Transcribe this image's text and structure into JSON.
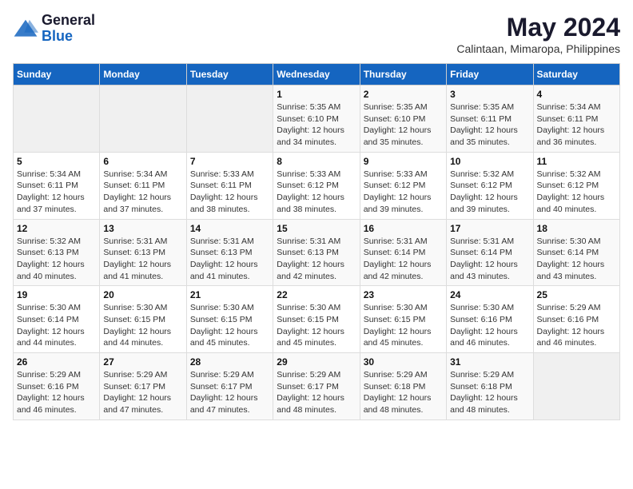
{
  "header": {
    "logo_general": "General",
    "logo_blue": "Blue",
    "month_year": "May 2024",
    "location": "Calintaan, Mimaropa, Philippines"
  },
  "days_of_week": [
    "Sunday",
    "Monday",
    "Tuesday",
    "Wednesday",
    "Thursday",
    "Friday",
    "Saturday"
  ],
  "weeks": [
    [
      {
        "day": "",
        "info": ""
      },
      {
        "day": "",
        "info": ""
      },
      {
        "day": "",
        "info": ""
      },
      {
        "day": "1",
        "info": "Sunrise: 5:35 AM\nSunset: 6:10 PM\nDaylight: 12 hours\nand 34 minutes."
      },
      {
        "day": "2",
        "info": "Sunrise: 5:35 AM\nSunset: 6:10 PM\nDaylight: 12 hours\nand 35 minutes."
      },
      {
        "day": "3",
        "info": "Sunrise: 5:35 AM\nSunset: 6:11 PM\nDaylight: 12 hours\nand 35 minutes."
      },
      {
        "day": "4",
        "info": "Sunrise: 5:34 AM\nSunset: 6:11 PM\nDaylight: 12 hours\nand 36 minutes."
      }
    ],
    [
      {
        "day": "5",
        "info": "Sunrise: 5:34 AM\nSunset: 6:11 PM\nDaylight: 12 hours\nand 37 minutes."
      },
      {
        "day": "6",
        "info": "Sunrise: 5:34 AM\nSunset: 6:11 PM\nDaylight: 12 hours\nand 37 minutes."
      },
      {
        "day": "7",
        "info": "Sunrise: 5:33 AM\nSunset: 6:11 PM\nDaylight: 12 hours\nand 38 minutes."
      },
      {
        "day": "8",
        "info": "Sunrise: 5:33 AM\nSunset: 6:12 PM\nDaylight: 12 hours\nand 38 minutes."
      },
      {
        "day": "9",
        "info": "Sunrise: 5:33 AM\nSunset: 6:12 PM\nDaylight: 12 hours\nand 39 minutes."
      },
      {
        "day": "10",
        "info": "Sunrise: 5:32 AM\nSunset: 6:12 PM\nDaylight: 12 hours\nand 39 minutes."
      },
      {
        "day": "11",
        "info": "Sunrise: 5:32 AM\nSunset: 6:12 PM\nDaylight: 12 hours\nand 40 minutes."
      }
    ],
    [
      {
        "day": "12",
        "info": "Sunrise: 5:32 AM\nSunset: 6:13 PM\nDaylight: 12 hours\nand 40 minutes."
      },
      {
        "day": "13",
        "info": "Sunrise: 5:31 AM\nSunset: 6:13 PM\nDaylight: 12 hours\nand 41 minutes."
      },
      {
        "day": "14",
        "info": "Sunrise: 5:31 AM\nSunset: 6:13 PM\nDaylight: 12 hours\nand 41 minutes."
      },
      {
        "day": "15",
        "info": "Sunrise: 5:31 AM\nSunset: 6:13 PM\nDaylight: 12 hours\nand 42 minutes."
      },
      {
        "day": "16",
        "info": "Sunrise: 5:31 AM\nSunset: 6:14 PM\nDaylight: 12 hours\nand 42 minutes."
      },
      {
        "day": "17",
        "info": "Sunrise: 5:31 AM\nSunset: 6:14 PM\nDaylight: 12 hours\nand 43 minutes."
      },
      {
        "day": "18",
        "info": "Sunrise: 5:30 AM\nSunset: 6:14 PM\nDaylight: 12 hours\nand 43 minutes."
      }
    ],
    [
      {
        "day": "19",
        "info": "Sunrise: 5:30 AM\nSunset: 6:14 PM\nDaylight: 12 hours\nand 44 minutes."
      },
      {
        "day": "20",
        "info": "Sunrise: 5:30 AM\nSunset: 6:15 PM\nDaylight: 12 hours\nand 44 minutes."
      },
      {
        "day": "21",
        "info": "Sunrise: 5:30 AM\nSunset: 6:15 PM\nDaylight: 12 hours\nand 45 minutes."
      },
      {
        "day": "22",
        "info": "Sunrise: 5:30 AM\nSunset: 6:15 PM\nDaylight: 12 hours\nand 45 minutes."
      },
      {
        "day": "23",
        "info": "Sunrise: 5:30 AM\nSunset: 6:15 PM\nDaylight: 12 hours\nand 45 minutes."
      },
      {
        "day": "24",
        "info": "Sunrise: 5:30 AM\nSunset: 6:16 PM\nDaylight: 12 hours\nand 46 minutes."
      },
      {
        "day": "25",
        "info": "Sunrise: 5:29 AM\nSunset: 6:16 PM\nDaylight: 12 hours\nand 46 minutes."
      }
    ],
    [
      {
        "day": "26",
        "info": "Sunrise: 5:29 AM\nSunset: 6:16 PM\nDaylight: 12 hours\nand 46 minutes."
      },
      {
        "day": "27",
        "info": "Sunrise: 5:29 AM\nSunset: 6:17 PM\nDaylight: 12 hours\nand 47 minutes."
      },
      {
        "day": "28",
        "info": "Sunrise: 5:29 AM\nSunset: 6:17 PM\nDaylight: 12 hours\nand 47 minutes."
      },
      {
        "day": "29",
        "info": "Sunrise: 5:29 AM\nSunset: 6:17 PM\nDaylight: 12 hours\nand 48 minutes."
      },
      {
        "day": "30",
        "info": "Sunrise: 5:29 AM\nSunset: 6:18 PM\nDaylight: 12 hours\nand 48 minutes."
      },
      {
        "day": "31",
        "info": "Sunrise: 5:29 AM\nSunset: 6:18 PM\nDaylight: 12 hours\nand 48 minutes."
      },
      {
        "day": "",
        "info": ""
      }
    ]
  ]
}
